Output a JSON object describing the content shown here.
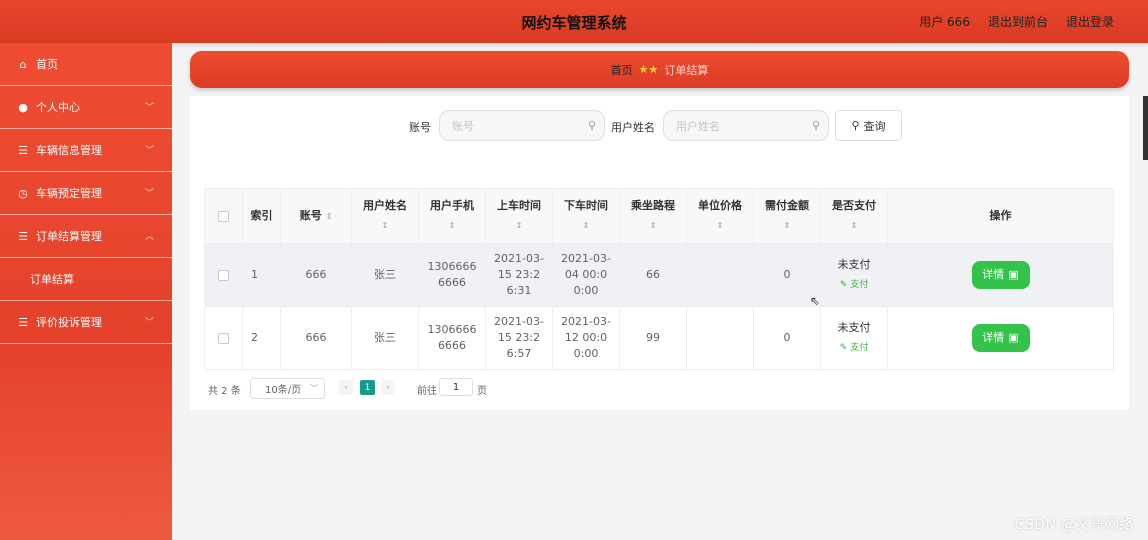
{
  "header": {
    "title": "网约车管理系统",
    "user": "用户 666",
    "back_front": "退出到前台",
    "logout": "退出登录"
  },
  "sidebar": {
    "items": [
      {
        "label": "首页",
        "icon": "home-icon"
      },
      {
        "label": "个人中心",
        "icon": "user-icon"
      },
      {
        "label": "车辆信息管理",
        "icon": "list-icon"
      },
      {
        "label": "车辆预定管理",
        "icon": "clock-icon"
      },
      {
        "label": "订单结算管理",
        "icon": "list-icon"
      },
      {
        "label": "评价投诉管理",
        "icon": "list-icon"
      }
    ],
    "submenu": {
      "label": "订单结算"
    }
  },
  "breadcrumb": {
    "home": "首页",
    "current": "订单结算"
  },
  "search": {
    "account_label": "账号",
    "account_placeholder": "账号",
    "name_label": "用户姓名",
    "name_placeholder": "用户姓名",
    "query_label": "查询"
  },
  "table": {
    "headers": [
      "索引",
      "账号",
      "用户姓名",
      "用户手机",
      "上车时间",
      "下车时间",
      "乘坐路程",
      "单位价格",
      "需付金额",
      "是否支付",
      "操作"
    ],
    "rows": [
      {
        "index": "1",
        "account": "666",
        "name": "张三",
        "phone": "13066666666",
        "board": "2021-03-15 23:26:31",
        "alight": "2021-03-04 00:00:00",
        "distance": "66",
        "unit_price": "",
        "amount": "0",
        "paid": "未支付",
        "pay_link": "支付",
        "detail": "详情"
      },
      {
        "index": "2",
        "account": "666",
        "name": "张三",
        "phone": "13066666666",
        "board": "2021-03-15 23:26:57",
        "alight": "2021-03-12 00:00:00",
        "distance": "99",
        "unit_price": "",
        "amount": "0",
        "paid": "未支付",
        "pay_link": "支付",
        "detail": "详情"
      }
    ]
  },
  "pagination": {
    "total": "共 2 条",
    "page_size": "10条/页",
    "current_page": "1",
    "goto_label": "前往",
    "goto_value": "1",
    "goto_unit": "页"
  },
  "watermark": "CSDN @文哥网络",
  "colors": {
    "primary": "#e4412a",
    "accent_green": "#35c24b",
    "page_active": "#169b88",
    "star": "#ffd43b"
  }
}
